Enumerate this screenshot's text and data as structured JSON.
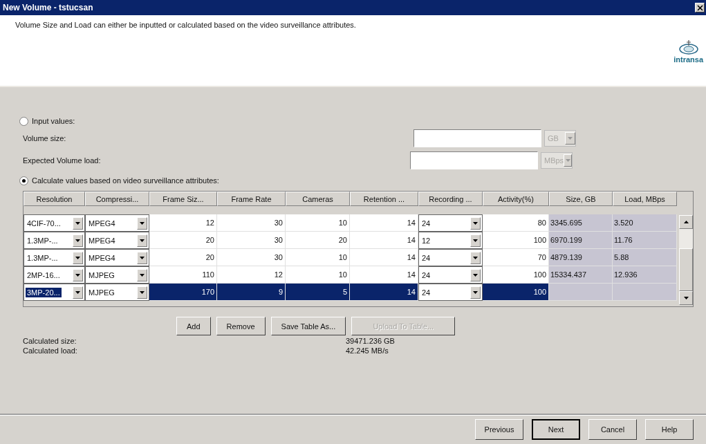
{
  "window": {
    "title": "New Volume - tstucsan"
  },
  "description": "Volume Size and Load can either be inputted or calculated based on the video surveillance attributes.",
  "logo": {
    "text": "intransa"
  },
  "input_option": {
    "label": "Input values:",
    "selected": false
  },
  "input_fields": [
    {
      "label": "Volume size:",
      "unit": "GB",
      "disabled": true
    },
    {
      "label": "Expected Volume load:",
      "unit": "MBps",
      "disabled": true
    }
  ],
  "calculate_option": {
    "label": "Calculate values based on video surveillance attributes:",
    "selected": true
  },
  "table": {
    "columns": [
      {
        "label": "Resolution",
        "kind": "dropdown"
      },
      {
        "label": "Compressi...",
        "kind": "dropdown"
      },
      {
        "label": "Frame Siz...",
        "kind": "number"
      },
      {
        "label": "Frame Rate",
        "kind": "number"
      },
      {
        "label": "Cameras",
        "kind": "number"
      },
      {
        "label": "Retention ...",
        "kind": "number"
      },
      {
        "label": "Recording ...",
        "kind": "dropdown"
      },
      {
        "label": "Activity(%)",
        "kind": "number"
      },
      {
        "label": "Size, GB",
        "kind": "computed"
      },
      {
        "label": "Load, MBps",
        "kind": "computed"
      }
    ],
    "rows": [
      {
        "selected": false,
        "cells": [
          "4CIF-70...",
          "MPEG4",
          "12",
          "30",
          "10",
          "14",
          "24",
          "80",
          "3345.695",
          "3.520"
        ]
      },
      {
        "selected": false,
        "cells": [
          "1.3MP-...",
          "MPEG4",
          "20",
          "30",
          "20",
          "14",
          "12",
          "100",
          "6970.199",
          "11.76"
        ]
      },
      {
        "selected": false,
        "cells": [
          "1.3MP-...",
          "MPEG4",
          "20",
          "30",
          "10",
          "14",
          "24",
          "70",
          "4879.139",
          "5.88"
        ]
      },
      {
        "selected": false,
        "cells": [
          "2MP-16...",
          "MJPEG",
          "110",
          "12",
          "10",
          "14",
          "24",
          "100",
          "15334.437",
          "12.936"
        ]
      },
      {
        "selected": true,
        "cells": [
          "3MP-20...",
          "MJPEG",
          "170",
          "9",
          "5",
          "14",
          "24",
          "100",
          "",
          ""
        ]
      }
    ]
  },
  "table_buttons": [
    {
      "label": "Add",
      "disabled": false
    },
    {
      "label": "Remove",
      "disabled": false
    },
    {
      "label": "Save Table As...",
      "disabled": false
    },
    {
      "label": "Upload To Table...",
      "disabled": true
    }
  ],
  "summary": [
    {
      "label": "Calculated size:",
      "value": "39471.236 GB"
    },
    {
      "label": "Calculated load:",
      "value": "42.245 MB/s"
    }
  ],
  "nav_buttons": [
    "Previous",
    "Next",
    "Cancel",
    "Help"
  ]
}
